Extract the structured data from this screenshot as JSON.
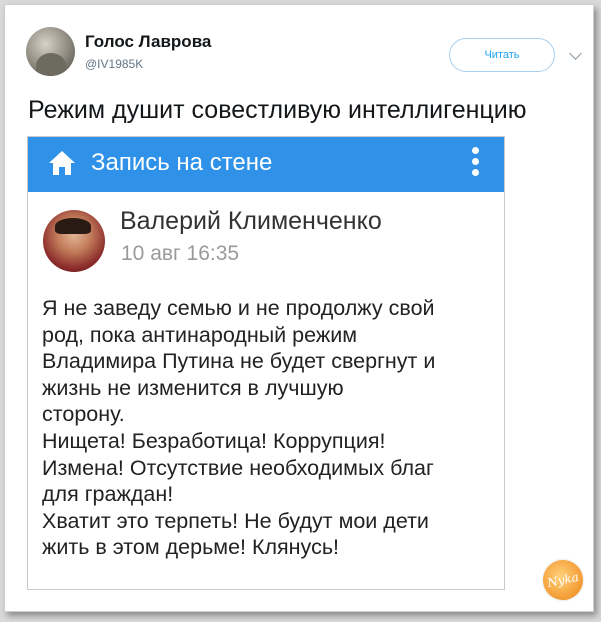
{
  "tweet": {
    "author_name": "Голос Лаврова",
    "author_handle": "@IV1985K",
    "follow_label": "Читать",
    "text": "Режим душит совестливую интеллигенцию"
  },
  "embed": {
    "header_title": "Запись на стене",
    "post_author": "Валерий Клименченко",
    "post_date": "10 авг 16:35",
    "body_lines": [
      "Я не заведу семью и не продолжу свой",
      "род, пока антинародный режим",
      "Владимира Путина не будет свергнут и",
      "жизнь не изменится в лучшую",
      "сторону.",
      "Нищета! Безработица! Коррупция!",
      "Измена! Отсутствие необходимых благ",
      "для граждан!",
      "Хватит это терпеть! Не будут мои дети",
      "жить в этом дерьме! Клянусь!"
    ]
  },
  "watermark": {
    "logo_text": "Nyka"
  },
  "icons": {
    "home": "home-icon",
    "menu": "more-vertical-icon",
    "caret": "chevron-down-icon"
  },
  "colors": {
    "header_blue": "#2f92e8",
    "follow_blue": "#1da1f2",
    "logo_orange": "#f5a23c"
  }
}
